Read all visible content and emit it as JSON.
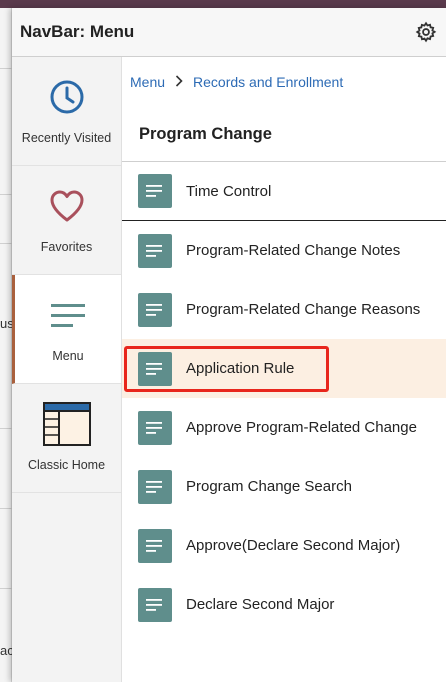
{
  "background": {
    "fragments": [
      "us",
      "ac"
    ]
  },
  "header": {
    "title": "NavBar: Menu"
  },
  "tabs": [
    {
      "label": "Recently Visited",
      "icon": "clock-icon"
    },
    {
      "label": "Favorites",
      "icon": "heart-icon"
    },
    {
      "label": "Menu",
      "icon": "menu-lines-icon"
    },
    {
      "label": "Classic Home",
      "icon": "classic-home-icon"
    }
  ],
  "breadcrumb": {
    "root": "Menu",
    "current": "Records and Enrollment"
  },
  "group_title": "Program Change",
  "items": [
    {
      "label": "Time Control"
    },
    {
      "label": "Program-Related Change Notes"
    },
    {
      "label": "Program-Related Change Reasons"
    },
    {
      "label": "Application Rule"
    },
    {
      "label": "Approve Program-Related Change"
    },
    {
      "label": "Program Change Search"
    },
    {
      "label": "Approve(Declare Second Major)"
    },
    {
      "label": "Declare Second Major"
    }
  ],
  "colors": {
    "accent": "#a9603d",
    "link": "#2d6bb5",
    "item_icon": "#5f8e8c",
    "tab_icon": "#2b6aa8",
    "favorites_icon": "#a9505c",
    "highlight_box": "#e8261c",
    "active_row": "#fcefe2"
  }
}
